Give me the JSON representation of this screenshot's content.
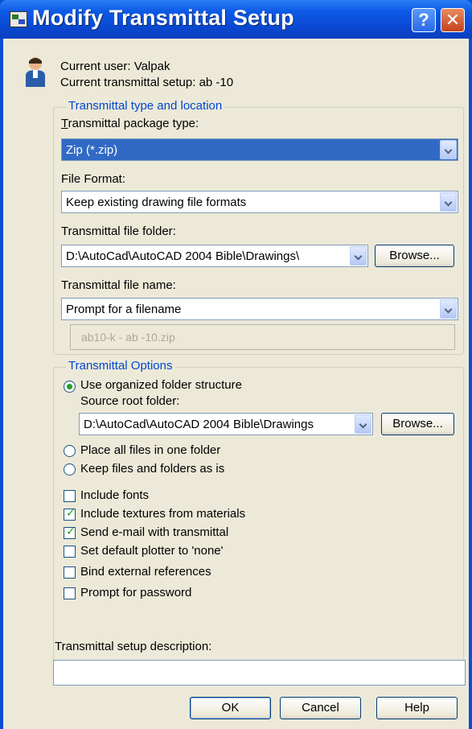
{
  "window": {
    "title": "Modify Transmittal Setup",
    "help_glyph": "?",
    "close_glyph": "✕"
  },
  "header": {
    "current_user": "Current user: Valpak",
    "current_setup": "Current transmittal setup: ab -10"
  },
  "type_location": {
    "group_label": "Transmittal type and location",
    "package_type_label": "Transmittal package type:",
    "package_type_value": "Zip (*.zip)",
    "file_format_label": "File Format:",
    "file_format_value": "Keep existing drawing file formats",
    "folder_label": "Transmittal file folder:",
    "folder_value": "D:\\AutoCad\\AutoCAD 2004 Bible\\Drawings\\",
    "browse_label": "Browse...",
    "file_name_label": "Transmittal file name:",
    "file_name_value": "Prompt for a filename",
    "file_name_preview": "ab10-k - ab -10.zip"
  },
  "options": {
    "group_label": "Transmittal Options",
    "radio_organized": "Use organized folder structure",
    "source_root_label": "Source root folder:",
    "source_root_value": "D:\\AutoCad\\AutoCAD 2004 Bible\\Drawings",
    "browse_label": "Browse...",
    "radio_one_folder": "Place all files in one folder",
    "radio_keep": "Keep files and folders as is",
    "checkboxes": [
      {
        "label": "Include fonts",
        "checked": false
      },
      {
        "label": "Include textures from materials",
        "checked": true
      },
      {
        "label": "Send e-mail with transmittal",
        "checked": true
      },
      {
        "label": "Set default plotter to 'none'",
        "checked": false
      },
      {
        "label": "Bind external references",
        "checked": false
      },
      {
        "label": "Prompt for password",
        "checked": false
      }
    ]
  },
  "description": {
    "label": "Transmittal setup description:",
    "value": ""
  },
  "buttons": {
    "ok": "OK",
    "cancel": "Cancel",
    "help": "Help"
  },
  "colors": {
    "titlebar": "#0a4fd6",
    "dialog_bg": "#ece9d8",
    "group_label": "#0046d5",
    "selection": "#316ac5",
    "check": "#21a121"
  },
  "icons": {
    "user": "user-icon",
    "app": "app-icon"
  }
}
